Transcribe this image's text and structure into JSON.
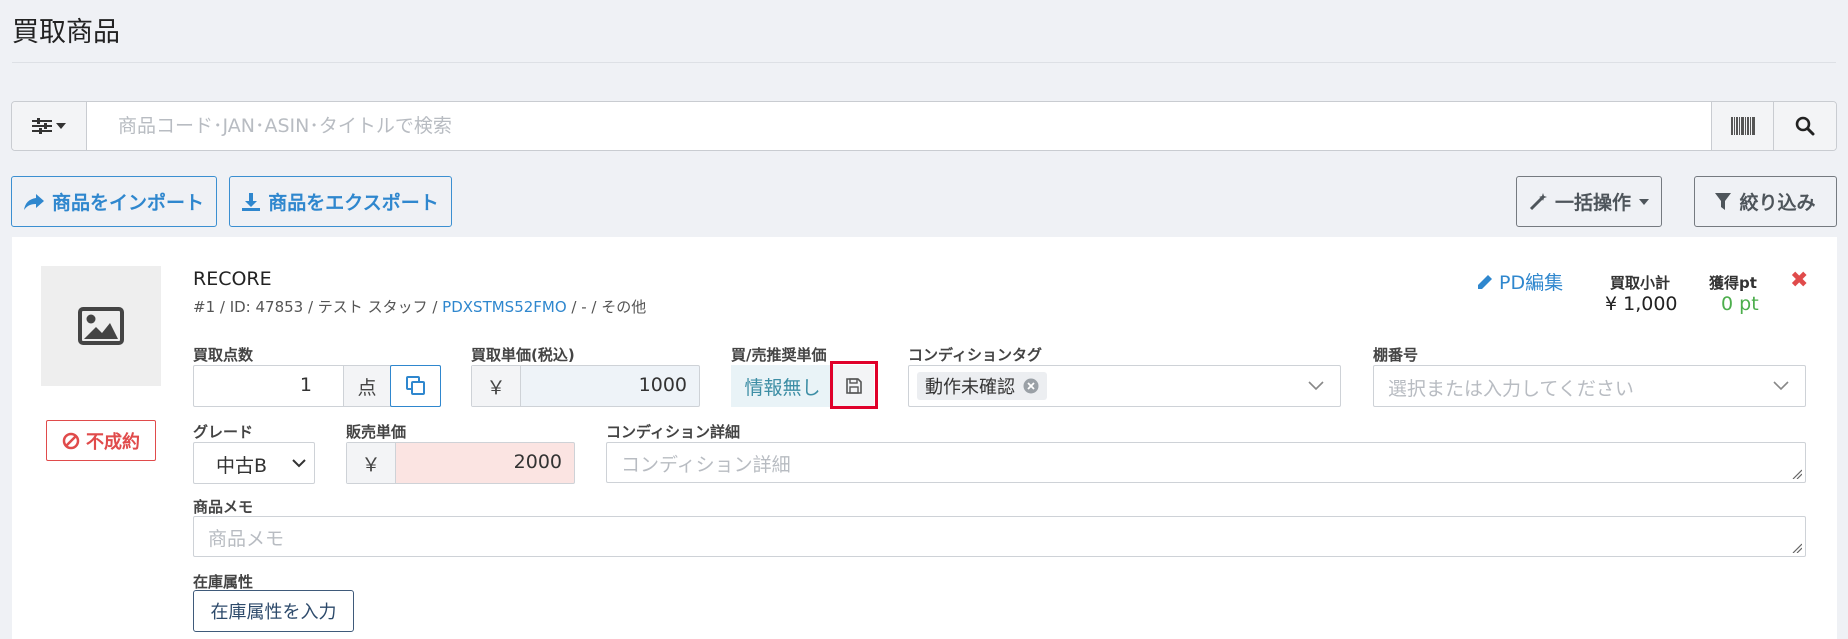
{
  "page_title": "買取商品",
  "search": {
    "placeholder": "商品コード･JAN･ASIN･タイトルで検索"
  },
  "toolbar": {
    "import_label": "商品をインポート",
    "export_label": "商品をエクスポート",
    "bulk_label": "一括操作",
    "filter_label": "絞り込み"
  },
  "item": {
    "status": "不成約",
    "name": "RECORE",
    "meta_prefix": "#1 / ID: 47853 / テスト スタッフ / ",
    "meta_link": "PDXSTMS52FMO",
    "meta_suffix": " / - / その他",
    "pd_edit_label": "PD編集",
    "subtotal_label": "買取小計",
    "subtotal_value": "¥ 1,000",
    "points_label": "獲得pt",
    "points_value": "0 pt",
    "quantity": {
      "label": "買取点数",
      "value": "1",
      "unit": "点"
    },
    "buy_price": {
      "label": "買取単価(税込)",
      "currency": "￥",
      "value": "1000"
    },
    "recommended": {
      "label": "買/売推奨単価",
      "value": "情報無し"
    },
    "condition_tag": {
      "label": "コンディションタグ",
      "tag": "動作未確認"
    },
    "shelf": {
      "label": "棚番号",
      "placeholder": "選択または入力してください"
    },
    "grade": {
      "label": "グレード",
      "value": "中古B"
    },
    "sell_price": {
      "label": "販売単価",
      "currency": "￥",
      "value": "2000"
    },
    "condition_detail": {
      "label": "コンディション詳細",
      "placeholder": "コンディション詳細"
    },
    "memo": {
      "label": "商品メモ",
      "placeholder": "商品メモ"
    },
    "stock_attr": {
      "label": "在庫属性",
      "button_label": "在庫属性を入力"
    }
  },
  "colors": {
    "accent_blue": "#2f87ce",
    "danger_red": "#e04b4b",
    "points_green": "#4cae4c",
    "highlight_red": "#e0002a",
    "buy_price_bg": "#eef3f8",
    "sell_price_bg": "#fbe4e2",
    "recommended_bg": "#e9f3f7"
  }
}
